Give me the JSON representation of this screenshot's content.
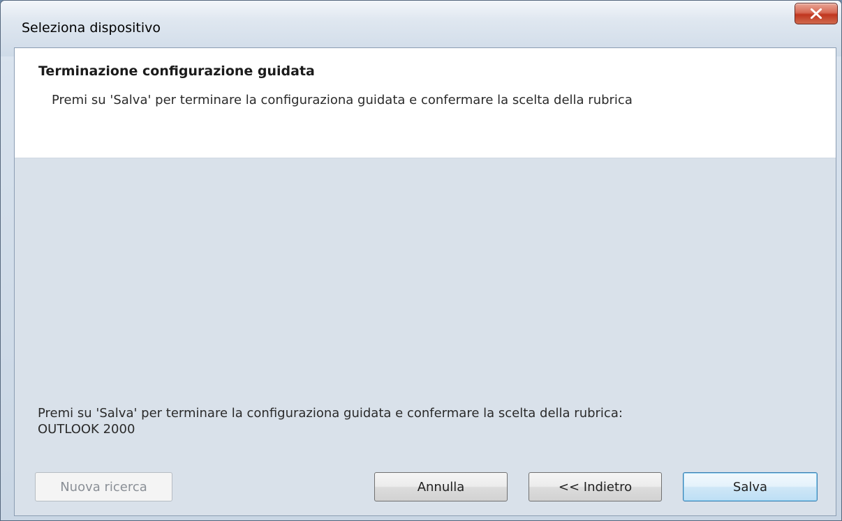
{
  "window": {
    "title": "Seleziona dispositivo",
    "close_icon": "close-x-icon"
  },
  "header": {
    "title": "Terminazione configurazione guidata",
    "description": "Premi su 'Salva' per terminare la configuraziona guidata e confermare la scelta della rubrica"
  },
  "body": {
    "message_line1": "Premi su 'Salva' per terminare la configuraziona guidata e confermare la scelta della rubrica:",
    "message_line2": "OUTLOOK 2000"
  },
  "buttons": {
    "new_search": "Nuova ricerca",
    "cancel": "Annulla",
    "back": "<< Indietro",
    "save": "Salva"
  },
  "colors": {
    "close_button": "#c0361f",
    "content_background": "#d9e1ea",
    "default_button_border": "#3c7fb1"
  }
}
